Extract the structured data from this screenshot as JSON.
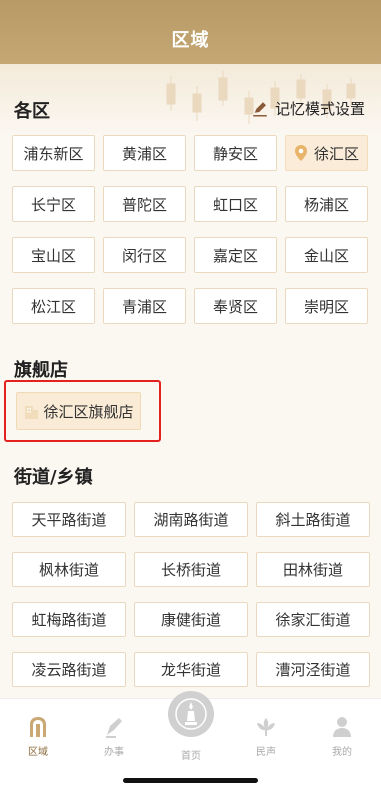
{
  "header": {
    "title": "区域"
  },
  "districts": {
    "title": "各区",
    "memory_setting": "记忆模式设置",
    "items": [
      "浦东新区",
      "黄浦区",
      "静安区",
      "徐汇区",
      "长宁区",
      "普陀区",
      "虹口区",
      "杨浦区",
      "宝山区",
      "闵行区",
      "嘉定区",
      "金山区",
      "松江区",
      "青浦区",
      "奉贤区",
      "崇明区"
    ],
    "selected": "徐汇区"
  },
  "flagship": {
    "title": "旗舰店",
    "item": "徐汇区旗舰店"
  },
  "streets": {
    "title": "街道/乡镇",
    "items": [
      "天平路街道",
      "湖南路街道",
      "斜土路街道",
      "枫林街道",
      "长桥街道",
      "田林街道",
      "虹梅路街道",
      "康健街道",
      "徐家汇街道",
      "凌云路街道",
      "龙华街道",
      "漕河泾街道"
    ]
  },
  "tabbar": {
    "items": [
      {
        "label": "区域",
        "icon": "region-icon"
      },
      {
        "label": "办事",
        "icon": "pen-icon"
      },
      {
        "label": "首页",
        "icon": "home-icon"
      },
      {
        "label": "民声",
        "icon": "lotus-icon"
      },
      {
        "label": "我的",
        "icon": "user-icon"
      }
    ],
    "active": "区域"
  },
  "colors": {
    "header": "#bfa06c",
    "accent": "#8a6a3a",
    "highlight": "#e3211f"
  }
}
